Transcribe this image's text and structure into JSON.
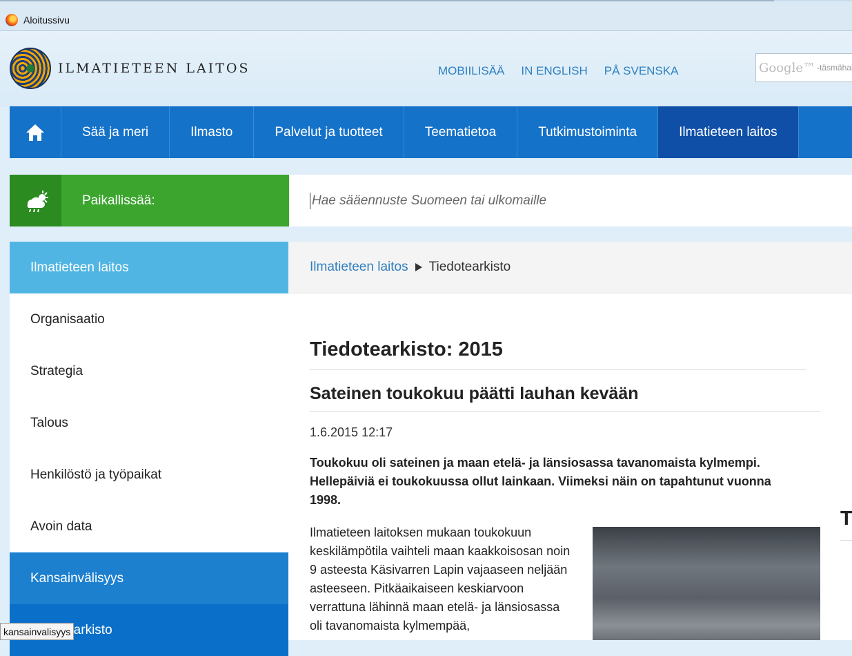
{
  "browser": {
    "tab_title": "Aloitussivu",
    "tab_icon": "firefox-icon"
  },
  "header": {
    "logo_text": "ILMATIETEEN LAITOS",
    "links": [
      "MOBIILISÄÄ",
      "IN ENGLISH",
      "PÅ SVENSKA"
    ],
    "google_search": {
      "brand": "Google™",
      "hint": "-täsmähak"
    }
  },
  "main_nav": {
    "home_icon": "home-icon",
    "items": [
      "Sää ja meri",
      "Ilmasto",
      "Palvelut ja tuotteet",
      "Teematietoa",
      "Tutkimustoiminta",
      "Ilmatieteen laitos"
    ],
    "active_index": 5
  },
  "local_weather": {
    "icon": "weather-cloud-sun-icon",
    "label": "Paikallissää:",
    "search_placeholder": "Hae sääennuste Suomeen tai ulkomaille"
  },
  "sidebar": {
    "header": "Ilmatieteen laitos",
    "items": [
      "Organisaatio",
      "Strategia",
      "Talous",
      "Henkilöstö ja työpaikat",
      "Avoin data",
      "Kansainvälisyys",
      "Tiedotearkisto"
    ]
  },
  "status_tooltip": "kansainvalisyys",
  "breadcrumb": {
    "parent": "Ilmatieteen laitos",
    "current": "Tiedotearkisto"
  },
  "article": {
    "page_title": "Tiedotearkisto: 2015",
    "headline": "Sateinen toukokuu päätti lauhan kevään",
    "date": "1.6.2015 12:17",
    "lead": "Toukokuu oli sateinen ja maan etelä- ja länsiosassa tavanomaista kylmempi. Hellepäiviä ei toukokuussa ollut lainkaan. Viimeksi näin on tapahtunut vuonna 1998.",
    "body": "Ilmatieteen laitoksen mukaan toukokuun keskilämpötila vaihteli maan kaakkoisosan noin 9 asteesta Käsivarren Lapin vajaaseen neljään asteeseen. Pitkäaikaiseen keskiarvoon verrattuna lähinnä maan etelä- ja länsiosassa oli tavanomaista kylmempää,"
  },
  "right_column_peek": "T"
}
